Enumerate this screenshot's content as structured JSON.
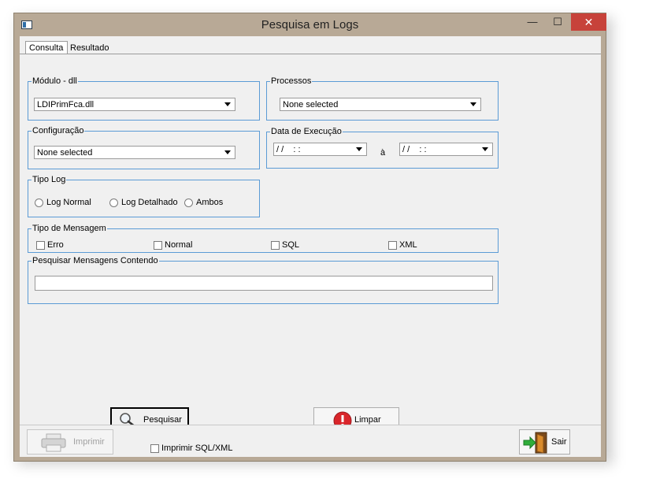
{
  "window": {
    "title": "Pesquisa em Logs",
    "minimize_glyph": "—",
    "maximize_glyph": "☐",
    "close_glyph": "✕"
  },
  "tabs": [
    {
      "label": "Consulta",
      "active": true
    },
    {
      "label": "Resultado",
      "active": false
    }
  ],
  "modulo": {
    "legend": "Módulo - dll",
    "value": "LDIPrimFca.dll"
  },
  "processos": {
    "legend": "Processos",
    "value": "None selected"
  },
  "configuracao": {
    "legend": "Configuração",
    "value": "None selected"
  },
  "data_execucao": {
    "legend": "Data de Execução",
    "from_value": "/ /    : :",
    "separator": "à",
    "to_value": "/ /    : :"
  },
  "tipo_log": {
    "legend": "Tipo Log",
    "options": [
      {
        "label": "Log Normal",
        "selected": false
      },
      {
        "label": "Log Detalhado",
        "selected": false
      },
      {
        "label": "Ambos",
        "selected": false
      }
    ]
  },
  "tipo_mensagem": {
    "legend": "Tipo de Mensagem",
    "options": [
      {
        "label": "Erro",
        "checked": false
      },
      {
        "label": "Normal",
        "checked": false
      },
      {
        "label": "SQL",
        "checked": false
      },
      {
        "label": "XML",
        "checked": false
      }
    ]
  },
  "pesquisar_mensagens": {
    "legend": "Pesquisar Mensagens Contendo",
    "value": ""
  },
  "buttons": {
    "pesquisar": "Pesquisar",
    "limpar": "Limpar",
    "imprimir": "Imprimir",
    "sair": "Sair"
  },
  "imprimir_sql_xml": {
    "label": "Imprimir SQL/XML",
    "checked": false
  },
  "icons": {
    "pesquisar": "magnifier-icon",
    "limpar": "error-icon",
    "imprimir": "printer-icon",
    "sair": "exit-door-icon"
  },
  "colors": {
    "groupbox_border": "#5b9bd5",
    "titlebar": "#b8a996",
    "close_button": "#c7423a"
  }
}
